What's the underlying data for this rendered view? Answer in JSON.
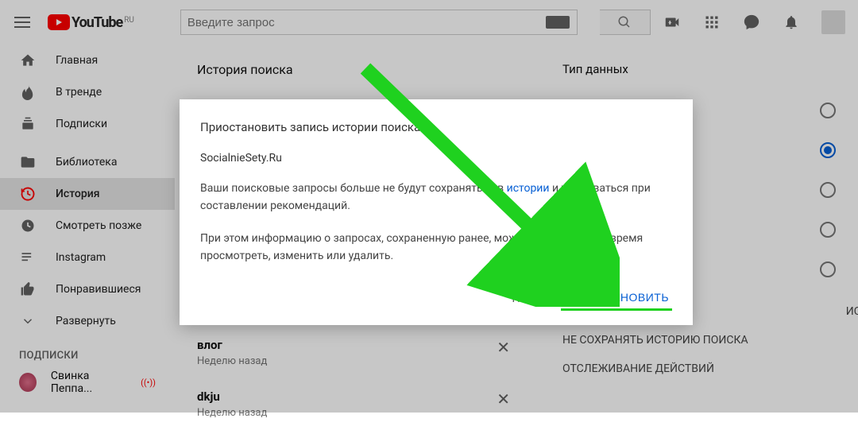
{
  "header": {
    "logo_text": "YouTube",
    "logo_region": "RU",
    "search_placeholder": "Введите запрос"
  },
  "sidebar": {
    "items": [
      {
        "label": "Главная"
      },
      {
        "label": "В тренде"
      },
      {
        "label": "Подписки"
      },
      {
        "label": "Библиотека"
      },
      {
        "label": "История"
      },
      {
        "label": "Смотреть позже"
      },
      {
        "label": "Instagram"
      },
      {
        "label": "Понравившиеся"
      },
      {
        "label": "Развернуть"
      }
    ],
    "subscriptions_heading": "ПОДПИСКИ",
    "channels": [
      {
        "name": "Свинка Пеппа...",
        "live": "((•))"
      }
    ]
  },
  "history": {
    "title": "История поиска",
    "items": [
      {
        "query": "влог",
        "meta": "Неделю назад"
      },
      {
        "query": "dkju",
        "meta": "Неделю назад"
      }
    ]
  },
  "data_type": {
    "title": "Тип данных",
    "actions": [
      "НЕ СОХРАНЯТЬ ИСТОРИЮ ПОИСКА",
      "ОТСЛЕЖИВАНИЕ ДЕЙСТВИЙ"
    ]
  },
  "modal": {
    "title": "Приостановить запись истории поиска?",
    "subtitle": "SocialnieSety.Ru",
    "p1_a": "Ваши поисковые запросы больше не будут сохраняться в ",
    "p1_link": "истории",
    "p1_b": " и учитываться при составлении рекомендаций.",
    "p2": "При этом информацию о запросах, сохраненную ранее, можно будет в любое время просмотреть, изменить или удалить.",
    "cancel": "НЕТ",
    "confirm": "ПРИОСТАНОВИТЬ"
  },
  "partial_label": "ИСКА"
}
